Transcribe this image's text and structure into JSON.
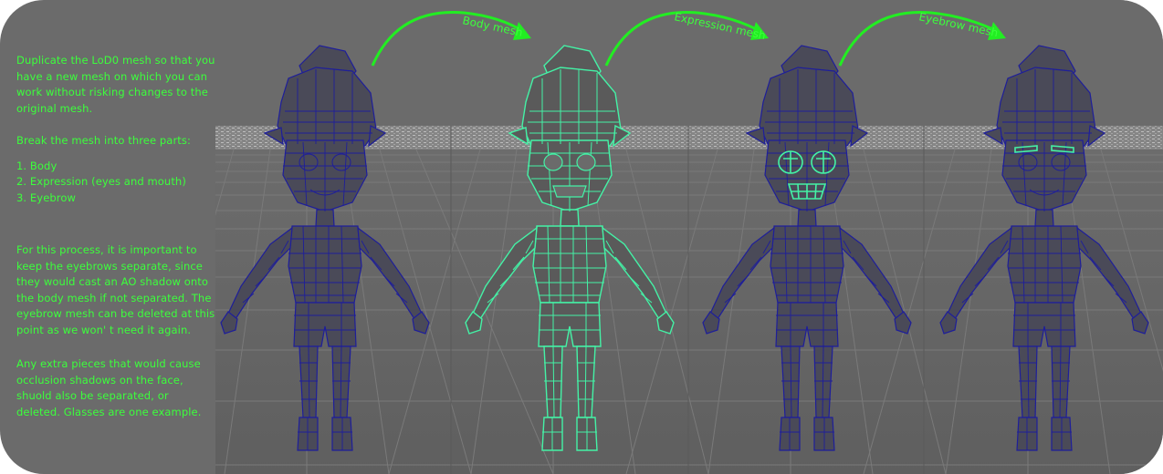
{
  "instructions": {
    "paragraph_1": "Duplicate the LoD0 mesh so that you have a new mesh on which you can work without risking changes to the original mesh.",
    "paragraph_2": "Break the mesh into three parts:",
    "steps": [
      "1. Body",
      "2. Expression (eyes and mouth)",
      "3. Eyebrow"
    ],
    "paragraph_3": "For this process, it is important to keep the eyebrows separate, since they would cast an AO shadow onto the body mesh if not separated. The eyebrow mesh can be deleted at this point as we won' t need it again.",
    "paragraph_4": "Any extra pieces that would cause occlusion shadows on the face, shuold also be separated, or deleted. Glasses are one example."
  },
  "arrows": [
    {
      "label": "Body mesh"
    },
    {
      "label": "Expression mesh"
    },
    {
      "label": "Eyebrow mesh"
    }
  ],
  "figures": [
    {
      "name": "original-mesh",
      "highlight": "none"
    },
    {
      "name": "body-mesh",
      "highlight": "body"
    },
    {
      "name": "expression-mesh",
      "highlight": "expression"
    },
    {
      "name": "eyebrow-mesh",
      "highlight": "eyebrow"
    }
  ],
  "colors": {
    "background": "#6b6b6b",
    "text": "#3cff3c",
    "wireframe_blue": "#1e1e9a",
    "highlight_green": "#44f2a6",
    "mesh_fill": "#4a4a55"
  }
}
